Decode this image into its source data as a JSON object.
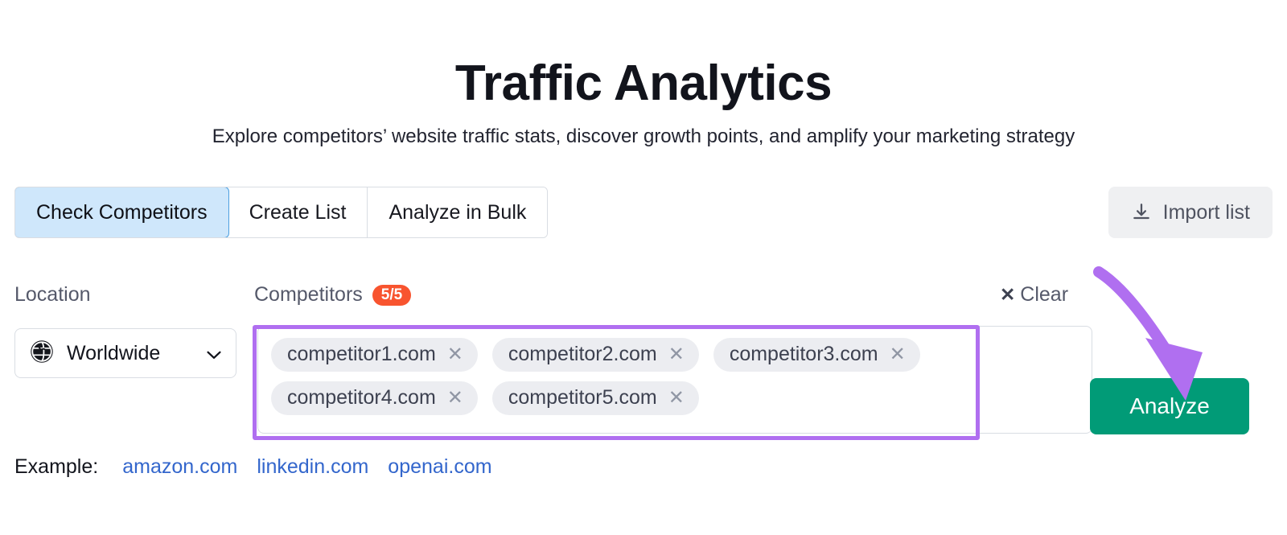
{
  "header": {
    "title": "Traffic Analytics",
    "subtitle": "Explore competitors’ website traffic stats, discover growth points, and amplify your marketing strategy"
  },
  "tabs": [
    {
      "label": "Check Competitors",
      "active": true
    },
    {
      "label": "Create List",
      "active": false
    },
    {
      "label": "Analyze in Bulk",
      "active": false
    }
  ],
  "toolbar": {
    "import_label": "Import list",
    "import_icon": "download-icon"
  },
  "fields": {
    "location_label": "Location",
    "competitors_label": "Competitors",
    "competitors_count": "5/5",
    "clear_label": "Clear",
    "clear_icon": "close-x-icon"
  },
  "location": {
    "value": "Worldwide",
    "icon": "globe-icon",
    "chevron_icon": "chevron-down-icon"
  },
  "competitors": {
    "chips": [
      {
        "domain": "competitor1.com",
        "remove_icon": "close-x-icon"
      },
      {
        "domain": "competitor2.com",
        "remove_icon": "close-x-icon"
      },
      {
        "domain": "competitor3.com",
        "remove_icon": "close-x-icon"
      },
      {
        "domain": "competitor4.com",
        "remove_icon": "close-x-icon"
      },
      {
        "domain": "competitor5.com",
        "remove_icon": "close-x-icon"
      }
    ]
  },
  "actions": {
    "analyze_label": "Analyze"
  },
  "examples": {
    "label": "Example:",
    "links": [
      "amazon.com",
      "linkedin.com",
      "openai.com"
    ]
  },
  "annotation": {
    "arrow": "curved-arrow-pointing-to-analyze-button",
    "arrow_color": "#b06ff0",
    "highlight_color": "#b06ff0"
  },
  "colors": {
    "accent_green": "#019b77",
    "badge_orange": "#f8542f",
    "active_tab_bg": "#cfe7fb",
    "active_tab_border": "#4b9fe0",
    "link_blue": "#3366cc",
    "chip_bg": "#ecedf1"
  }
}
